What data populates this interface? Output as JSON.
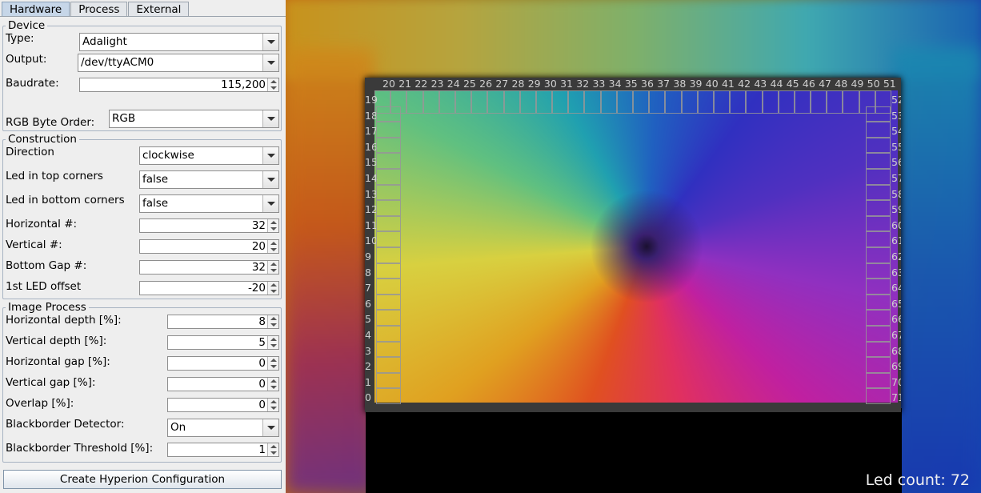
{
  "tabs": [
    "Hardware",
    "Process",
    "External"
  ],
  "device": {
    "legend": "Device",
    "type_label": "Type:",
    "type_value": "Adalight",
    "output_label": "Output:",
    "output_value": "/dev/ttyACM0",
    "baud_label": "Baudrate:",
    "baud_value": "115,200",
    "rgb_label": "RGB Byte Order:",
    "rgb_value": "RGB"
  },
  "construction": {
    "legend": "Construction",
    "direction_label": "Direction",
    "direction_value": "clockwise",
    "top_corners_label": "Led in top corners",
    "top_corners_value": "false",
    "bottom_corners_label": "Led in bottom corners",
    "bottom_corners_value": "false",
    "horizontal_label": "Horizontal #:",
    "horizontal_value": "32",
    "vertical_label": "Vertical #:",
    "vertical_value": "20",
    "bottom_gap_label": "Bottom Gap #:",
    "bottom_gap_value": "32",
    "offset_label": "1st LED offset",
    "offset_value": "-20"
  },
  "image_process": {
    "legend": "Image Process",
    "h_depth_label": "Horizontal depth [%]:",
    "h_depth_value": "8",
    "v_depth_label": "Vertical depth [%]:",
    "v_depth_value": "5",
    "h_gap_label": "Horizontal gap [%]:",
    "h_gap_value": "0",
    "v_gap_label": "Vertical gap [%]:",
    "v_gap_value": "0",
    "overlap_label": "Overlap [%]:",
    "overlap_value": "0",
    "bb_detector_label": "Blackborder Detector:",
    "bb_detector_value": "On",
    "bb_threshold_label": "Blackborder Threshold [%]:",
    "bb_threshold_value": "1"
  },
  "create_button": "Create Hyperion Configuration",
  "preview": {
    "top_numbers": [
      "20",
      "21",
      "22",
      "23",
      "24",
      "25",
      "26",
      "27",
      "28",
      "29",
      "30",
      "31",
      "32",
      "33",
      "34",
      "35",
      "36",
      "37",
      "38",
      "39",
      "40",
      "41",
      "42",
      "43",
      "44",
      "45",
      "46",
      "47",
      "48",
      "49",
      "50",
      "51"
    ],
    "left_numbers": [
      "19",
      "18",
      "17",
      "16",
      "15",
      "14",
      "13",
      "12",
      "11",
      "10",
      "9",
      "8",
      "7",
      "6",
      "5",
      "4",
      "3",
      "2",
      "1",
      "0"
    ],
    "right_numbers": [
      "52",
      "53",
      "54",
      "55",
      "56",
      "57",
      "58",
      "59",
      "60",
      "61",
      "62",
      "63",
      "64",
      "65",
      "66",
      "67",
      "68",
      "69",
      "70",
      "71"
    ],
    "led_count": "Led count: 72"
  }
}
